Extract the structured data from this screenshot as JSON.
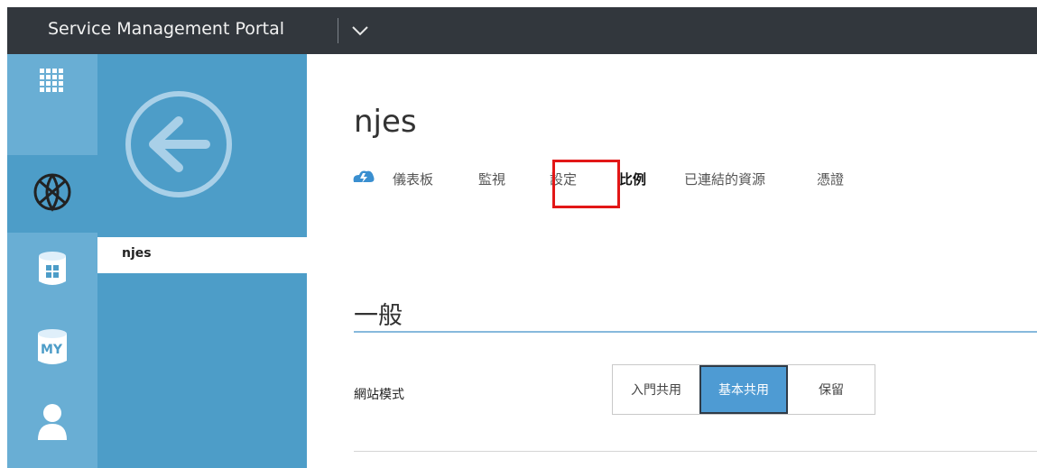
{
  "header": {
    "app_title": "Service Management Portal"
  },
  "rail": {
    "items": [
      {
        "icon": "all-items-grid-icon"
      },
      {
        "icon": "web-sites-globe-icon",
        "active": true
      },
      {
        "icon": "sql-database-icon"
      },
      {
        "icon": "mysql-database-icon",
        "label": "MY"
      },
      {
        "icon": "my-account-user-icon"
      }
    ]
  },
  "sidebar": {
    "selected_item": "njes"
  },
  "main": {
    "title": "njes",
    "tabs": [
      {
        "label": "儀表板"
      },
      {
        "label": "監視"
      },
      {
        "label": "設定"
      },
      {
        "label": "比例",
        "active": true
      },
      {
        "label": "已連結的資源"
      },
      {
        "label": "憑證"
      }
    ],
    "section_title": "一般",
    "site_mode": {
      "label": "網站模式",
      "options": [
        "入門共用",
        "基本共用",
        "保留"
      ],
      "selected": "基本共用"
    }
  },
  "colors": {
    "topbar": "#32373d",
    "rail": "#69aed4",
    "sidebar": "#4d9dc8",
    "accent": "#4e9bd3",
    "highlight": "#e21717"
  }
}
